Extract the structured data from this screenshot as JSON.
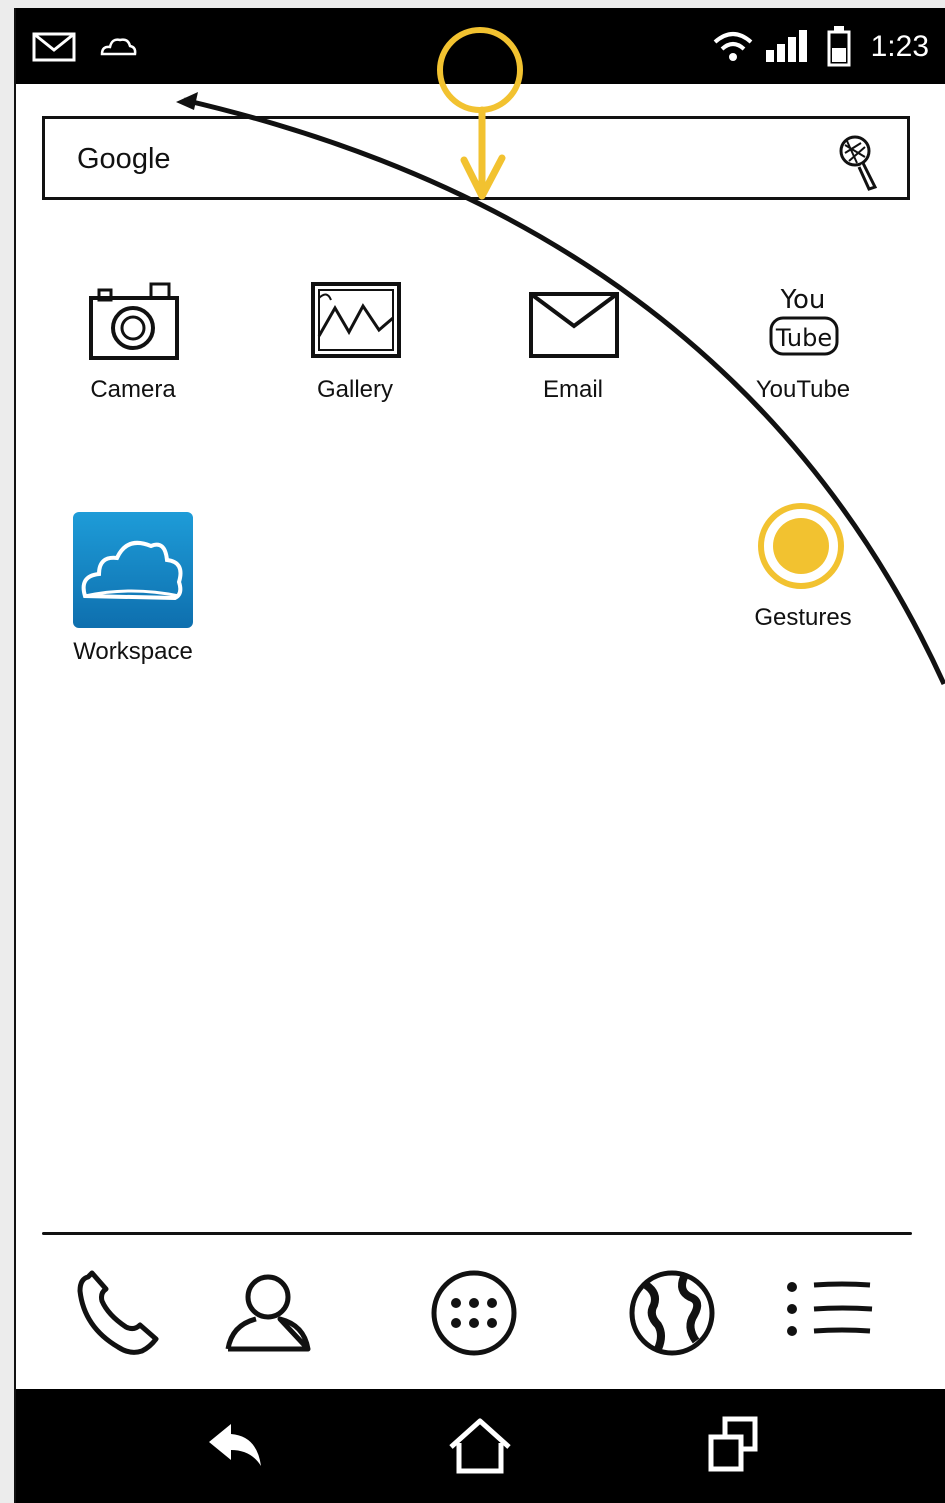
{
  "status_bar": {
    "time": "1:23",
    "left_icons": [
      "mail-icon",
      "cloud-icon"
    ],
    "right_icons": [
      "wifi-icon",
      "signal-icon",
      "battery-icon"
    ]
  },
  "search": {
    "label": "Google",
    "icon": "microphone-icon"
  },
  "apps": [
    {
      "label": "Camera",
      "icon": "camera-icon"
    },
    {
      "label": "Gallery",
      "icon": "gallery-icon"
    },
    {
      "label": "Email",
      "icon": "email-icon"
    },
    {
      "label": "YouTube",
      "icon": "youtube-icon"
    },
    {
      "label": "Workspace",
      "icon": "workspace-cloud-icon"
    },
    {
      "label": "Gestures",
      "icon": "gestures-icon"
    }
  ],
  "dock": [
    "phone-icon",
    "contacts-icon",
    "app-drawer-icon",
    "browser-globe-icon",
    "menu-list-icon"
  ],
  "nav_bar": [
    "back-icon",
    "home-icon",
    "recent-apps-icon"
  ],
  "colors": {
    "accent": "#f2c230",
    "ink": "#111111",
    "workspace_top": "#1e9cd8",
    "workspace_bottom": "#0e6fae"
  }
}
